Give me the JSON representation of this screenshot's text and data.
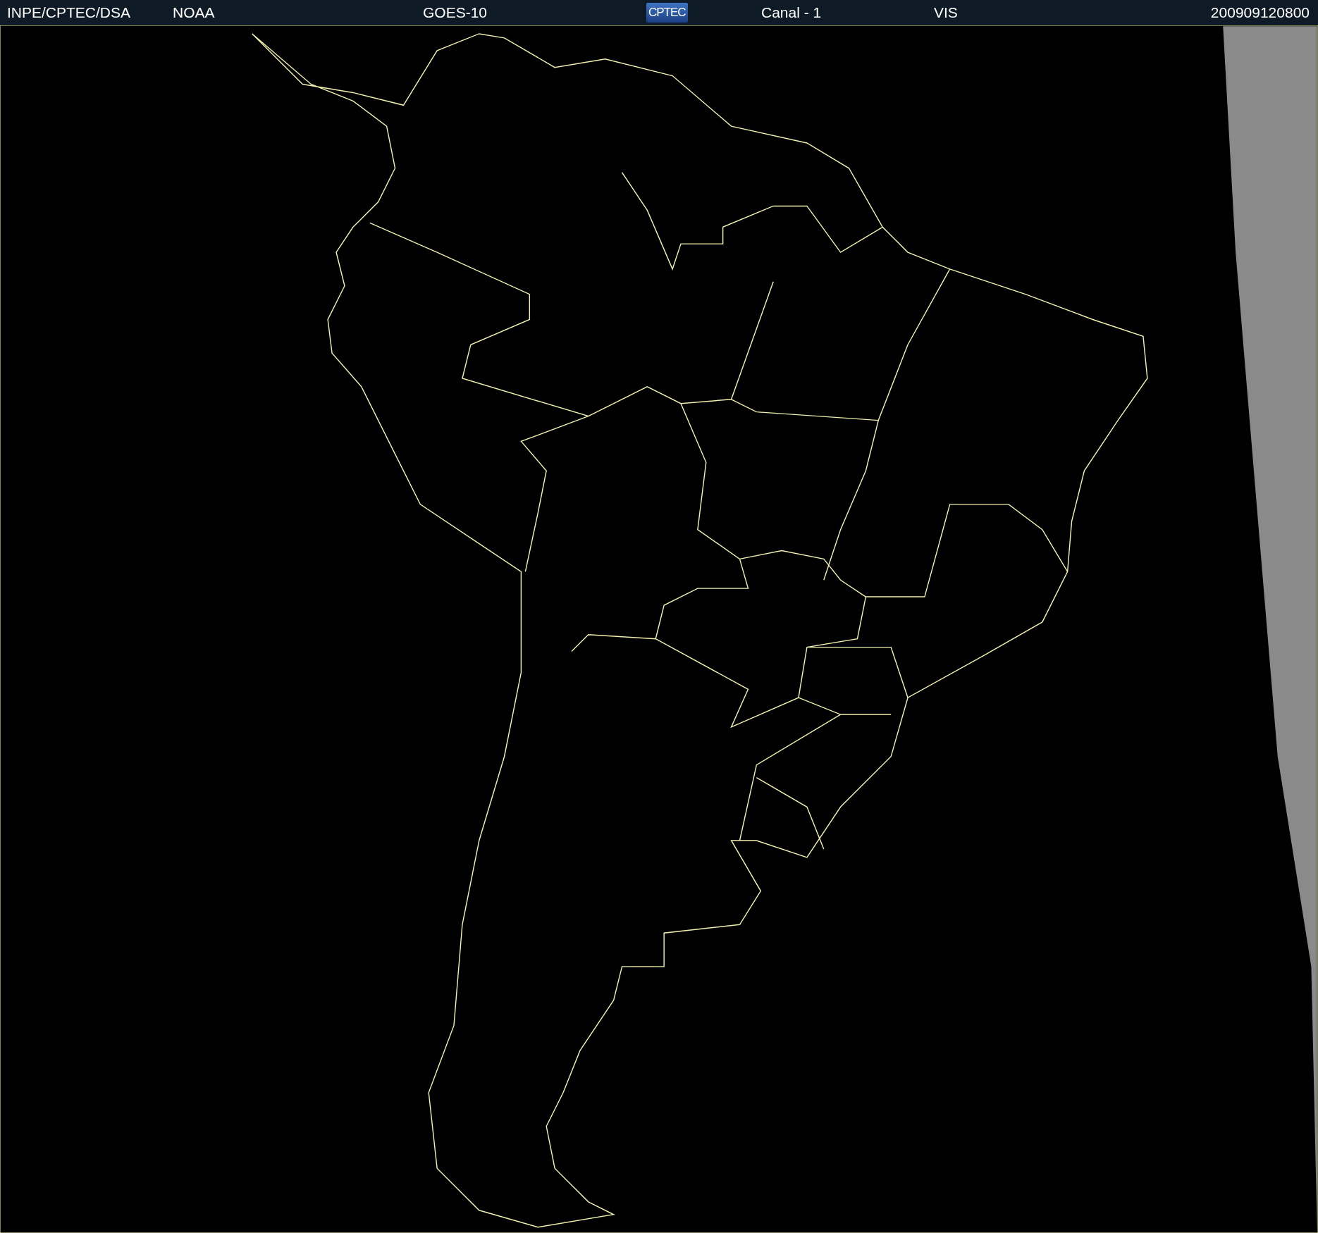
{
  "header": {
    "source": "INPE/CPTEC/DSA",
    "agency": "NOAA",
    "satellite": "GOES-10",
    "logo": "CPTEC",
    "channel": "Canal - 1",
    "band": "VIS",
    "timestamp": "200909120800"
  }
}
